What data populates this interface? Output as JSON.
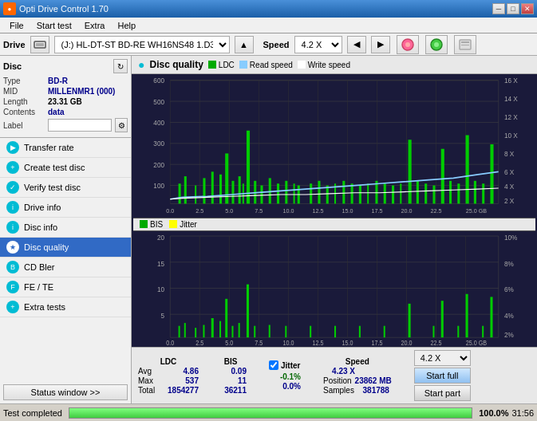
{
  "titlebar": {
    "title": "Opti Drive Control 1.70",
    "icon": "●",
    "buttons": [
      "─",
      "□",
      "✕"
    ]
  },
  "menubar": {
    "items": [
      "File",
      "Start test",
      "Extra",
      "Help"
    ]
  },
  "drivebar": {
    "drive_label": "Drive",
    "drive_value": "(J:)  HL-DT-ST BD-RE  WH16NS48 1.D3",
    "speed_label": "Speed",
    "speed_value": "4.2 X"
  },
  "disc": {
    "title": "Disc",
    "type_label": "Type",
    "type_value": "BD-R",
    "mid_label": "MID",
    "mid_value": "MILLENMR1 (000)",
    "length_label": "Length",
    "length_value": "23.31 GB",
    "contents_label": "Contents",
    "contents_value": "data",
    "label_label": "Label",
    "label_value": ""
  },
  "nav": {
    "items": [
      {
        "id": "transfer-rate",
        "label": "Transfer rate"
      },
      {
        "id": "create-test-disc",
        "label": "Create test disc"
      },
      {
        "id": "verify-test-disc",
        "label": "Verify test disc"
      },
      {
        "id": "drive-info",
        "label": "Drive info"
      },
      {
        "id": "disc-info",
        "label": "Disc info"
      },
      {
        "id": "disc-quality",
        "label": "Disc quality",
        "active": true
      },
      {
        "id": "cd-bler",
        "label": "CD Bler"
      },
      {
        "id": "fe-te",
        "label": "FE / TE"
      },
      {
        "id": "extra-tests",
        "label": "Extra tests"
      }
    ],
    "status_window": "Status window >>"
  },
  "chart": {
    "title": "Disc quality",
    "legend": [
      {
        "label": "LDC",
        "color": "#00aa00"
      },
      {
        "label": "Read speed",
        "color": "#88ccff"
      },
      {
        "label": "Write speed",
        "color": "#ffffff"
      }
    ],
    "legend2": [
      {
        "label": "BIS",
        "color": "#00aa00"
      },
      {
        "label": "Jitter",
        "color": "#ffff00"
      }
    ],
    "top_y_labels": [
      "600",
      "500",
      "400",
      "300",
      "200",
      "100"
    ],
    "top_y_right_labels": [
      "16 X",
      "14 X",
      "12 X",
      "10 X",
      "8 X",
      "6 X",
      "4 X",
      "2 X"
    ],
    "bottom_y_labels": [
      "20",
      "15",
      "10",
      "5"
    ],
    "bottom_y_right_labels": [
      "10%",
      "8%",
      "6%",
      "4%",
      "2%"
    ],
    "x_labels": [
      "0.0",
      "2.5",
      "5.0",
      "7.5",
      "10.0",
      "12.5",
      "15.0",
      "17.5",
      "20.0",
      "22.5",
      "25.0 GB"
    ]
  },
  "stats": {
    "headers": [
      "LDC",
      "BIS",
      "",
      "Jitter",
      "Speed"
    ],
    "avg_label": "Avg",
    "avg_ldc": "4.86",
    "avg_bis": "0.09",
    "avg_jitter": "-0.1%",
    "max_label": "Max",
    "max_ldc": "537",
    "max_bis": "11",
    "max_jitter": "0.0%",
    "total_label": "Total",
    "total_ldc": "1854277",
    "total_bis": "36211",
    "speed_avg": "4.23 X",
    "speed_label": "Speed",
    "position_label": "Position",
    "position_value": "23862 MB",
    "samples_label": "Samples",
    "samples_value": "381788",
    "speed_select": "4.2 X",
    "start_full": "Start full",
    "start_part": "Start part"
  },
  "statusbar": {
    "text": "Test completed",
    "progress": 100,
    "time": "31:56"
  }
}
